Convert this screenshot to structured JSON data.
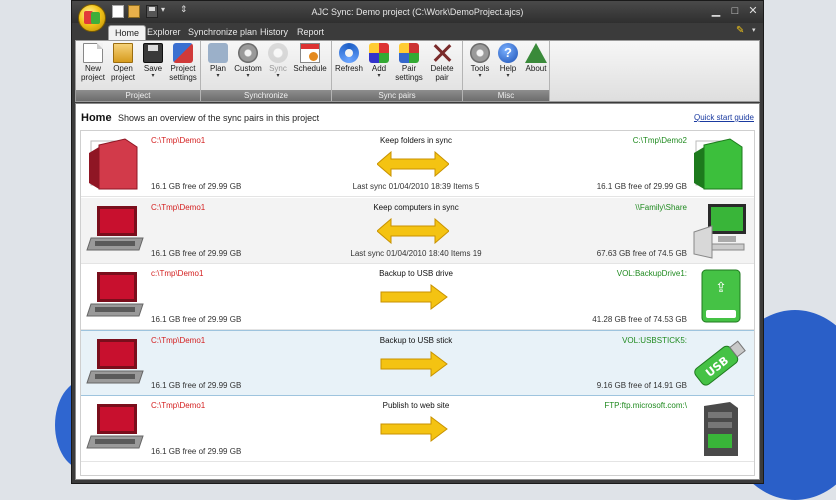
{
  "window": {
    "title": "AJC Sync: Demo project (C:\\Work\\DemoProject.ajcs)",
    "logo_icon": "app-logo-icon"
  },
  "quick_access": {
    "more_label": "⇕"
  },
  "window_controls": {
    "minimize": "▁",
    "maximize": "□",
    "close": "✕"
  },
  "tabs": [
    {
      "label": "Home",
      "active": true
    },
    {
      "label": "Explorer"
    },
    {
      "label": "Synchronize plan"
    },
    {
      "label": "History"
    },
    {
      "label": "Report"
    }
  ],
  "tab_style_icon": "paintbrush-icon",
  "ribbon": {
    "groups": {
      "project": "Project",
      "synchronize": "Synchronize",
      "sync_pairs": "Sync pairs",
      "misc": "Misc"
    },
    "buttons": {
      "new_project": "New project",
      "open_project": "Open project",
      "save": "Save",
      "project_settings": "Project settings",
      "plan": "Plan",
      "custom": "Custom",
      "sync": "Sync",
      "schedule": "Schedule",
      "refresh": "Refresh",
      "add": "Add",
      "pair_settings": "Pair settings",
      "delete_pair": "Delete pair",
      "tools": "Tools",
      "help": "Help",
      "about": "About"
    },
    "dropdown_arrow": "▾"
  },
  "home": {
    "title": "Home",
    "subtitle": "Shows an overview of the sync pairs in this project",
    "quick_start": "Quick start guide"
  },
  "colors": {
    "left_path": "#d42020",
    "right_path": "#1f8a1f",
    "arrow_fill": "#f4c312",
    "arrow_stroke": "#c89200",
    "accent_green": "#39b539",
    "laptop_red": "#c8102e"
  },
  "pairs": [
    {
      "name": "Keep folders in sync",
      "left_path": "C:\\Tmp\\Demo1",
      "right_path": "C:\\Tmp\\Demo2",
      "left_free": "16.1 GB free of 29.99 GB",
      "right_free": "16.1 GB free of 29.99 GB",
      "last_sync": "Last sync 01/04/2010 18:39  Items 5",
      "direction": "both",
      "left_icon": "red-folder-icon",
      "right_icon": "green-folder-icon"
    },
    {
      "name": "Keep computers in sync",
      "left_path": "C:\\Tmp\\Demo1",
      "right_path": "\\\\Family\\Share",
      "left_free": "16.1 GB free of 29.99 GB",
      "right_free": "67.63 GB free of 74.5 GB",
      "last_sync": "Last sync 01/04/2010 18:40  Items 19",
      "direction": "both",
      "left_icon": "red-laptop-icon",
      "right_icon": "green-computer-icon"
    },
    {
      "name": "Backup to USB drive",
      "left_path": "c:\\Tmp\\Demo1",
      "right_path": "VOL:BackupDrive1:",
      "left_free": "16.1 GB free of 29.99 GB",
      "right_free": "41.28 GB free of 74.53 GB",
      "last_sync": "",
      "direction": "right",
      "left_icon": "red-laptop-icon",
      "right_icon": "green-usb-drive-icon"
    },
    {
      "name": "Backup to USB stick",
      "left_path": "C:\\Tmp\\Demo1",
      "right_path": "VOL:USBSTICK5:",
      "left_free": "16.1 GB free of 29.99 GB",
      "right_free": "9.16 GB free of 14.91 GB",
      "last_sync": "",
      "direction": "right",
      "left_icon": "red-laptop-icon",
      "right_icon": "green-usb-stick-icon",
      "selected": true
    },
    {
      "name": "Publish to web site",
      "left_path": "C:\\Tmp\\Demo1",
      "right_path": "FTP:ftp.microsoft.com:\\",
      "left_free": "16.1 GB free of 29.99 GB",
      "right_free": "",
      "last_sync": "",
      "direction": "right",
      "left_icon": "red-laptop-icon",
      "right_icon": "server-icon"
    }
  ]
}
